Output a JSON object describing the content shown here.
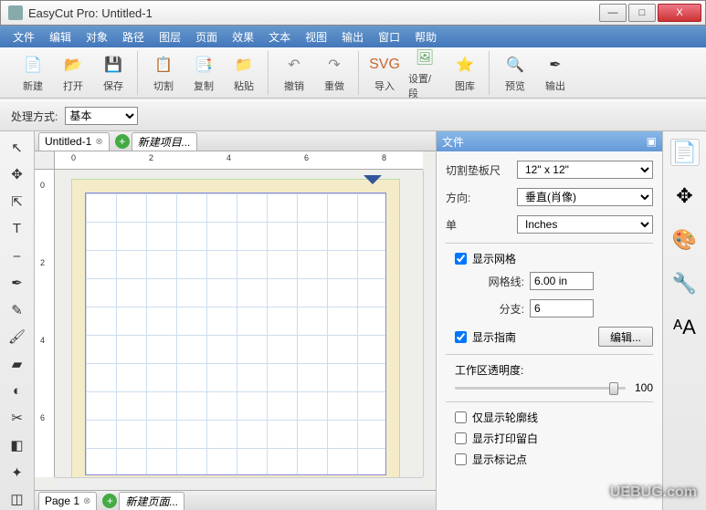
{
  "title": "EasyCut Pro: Untitled-1",
  "window_controls": {
    "min": "—",
    "max": "□",
    "close": "X"
  },
  "menu": [
    "文件",
    "编辑",
    "对象",
    "路径",
    "图层",
    "页面",
    "效果",
    "文本",
    "视图",
    "输出",
    "窗口",
    "帮助"
  ],
  "toolbar": [
    {
      "icon": "📄",
      "label": "新建",
      "name": "new-button",
      "color": "#3a3"
    },
    {
      "icon": "📂",
      "label": "打开",
      "name": "open-button",
      "color": "#37c"
    },
    {
      "icon": "💾",
      "label": "保存",
      "name": "save-button",
      "color": "#356"
    },
    {
      "sep": true
    },
    {
      "icon": "📋",
      "label": "切割",
      "name": "cut-button",
      "color": "#ca6"
    },
    {
      "icon": "📑",
      "label": "复制",
      "name": "copy-button",
      "color": "#ca6"
    },
    {
      "icon": "📁",
      "label": "粘贴",
      "name": "paste-button",
      "color": "#ca6"
    },
    {
      "sep": true
    },
    {
      "icon": "↶",
      "label": "撤销",
      "name": "undo-button",
      "color": "#888"
    },
    {
      "icon": "↷",
      "label": "重做",
      "name": "redo-button",
      "color": "#888"
    },
    {
      "sep": true
    },
    {
      "icon": "SVG",
      "label": "导入",
      "name": "import-button",
      "color": "#c63"
    },
    {
      "icon": "🖼",
      "label": "设置/段",
      "name": "setup-button",
      "color": "#6a6"
    },
    {
      "icon": "⭐",
      "label": "图库",
      "name": "library-button",
      "color": "#cc3"
    },
    {
      "sep": true
    },
    {
      "icon": "🔍",
      "label": "预览",
      "name": "preview-button",
      "color": "#555"
    },
    {
      "icon": "✒",
      "label": "输出",
      "name": "output-button",
      "color": "#333"
    }
  ],
  "processing": {
    "label": "处理方式:",
    "value": "基本"
  },
  "document_tabs": [
    {
      "label": "Untitled-1",
      "italic": false
    },
    {
      "label": "新建项目...",
      "italic": true
    }
  ],
  "ruler_marks_h": [
    0,
    2,
    4,
    6,
    8
  ],
  "ruler_marks_v": [
    0,
    2,
    4,
    6
  ],
  "page_tabs": [
    {
      "label": "Page 1",
      "italic": false
    },
    {
      "label": "新建页面...",
      "italic": true
    }
  ],
  "left_tools": [
    {
      "g": "↖",
      "name": "select-tool"
    },
    {
      "g": "✥",
      "name": "move-tool"
    },
    {
      "g": "⇱",
      "name": "node-tool"
    },
    {
      "g": "T",
      "name": "text-tool"
    },
    {
      "g": "⎯",
      "name": "line-tool"
    },
    {
      "g": "✒",
      "name": "pen-tool"
    },
    {
      "g": "✎",
      "name": "pencil-tool"
    },
    {
      "g": "🖌",
      "name": "brush-tool"
    },
    {
      "g": "▰",
      "name": "eraser-tool"
    },
    {
      "g": "◐",
      "name": "gradient-tool"
    },
    {
      "g": "✂",
      "name": "knife-tool"
    },
    {
      "g": "◧",
      "name": "crop-tool"
    },
    {
      "g": "✦",
      "name": "shape-tool"
    },
    {
      "g": "◫",
      "name": "measure-tool"
    }
  ],
  "right_strip": [
    {
      "g": "📄",
      "name": "new-doc-icon"
    },
    {
      "g": "✥",
      "name": "move-panel-icon"
    },
    {
      "g": "🎨",
      "name": "color-panel-icon"
    },
    {
      "g": "🔧",
      "name": "wrench-icon"
    },
    {
      "g": "ᴬA",
      "name": "text-panel-icon"
    }
  ],
  "panel": {
    "title": "文件",
    "mat_label": "切割垫板尺",
    "mat_value": "12\" x 12\"",
    "orient_label": "方向:",
    "orient_value": "垂直(肖像)",
    "units_label": "单",
    "units_value": "Inches",
    "show_grid": "显示网格",
    "grid_line_label": "网格线:",
    "grid_line_value": "6.00 in",
    "subdiv_label": "分支:",
    "subdiv_value": "6",
    "show_guides": "显示指南",
    "edit_btn": "编辑...",
    "opacity_label": "工作区透明度:",
    "opacity_value": "100",
    "outline_only": "仅显示轮廓线",
    "print_margin": "显示打印留白",
    "show_marks": "显示标记点"
  },
  "watermark": "UEBUG.com"
}
